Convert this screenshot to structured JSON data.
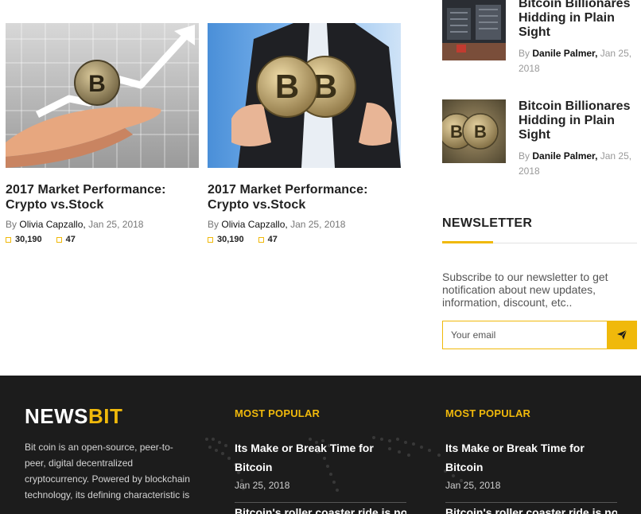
{
  "articles": [
    {
      "title": "2017 Market Performance: Crypto vs.Stock",
      "by": "By",
      "author": "Olivia Capzallo,",
      "date": "Jan 25, 2018",
      "views": "30,190",
      "comments": "47"
    },
    {
      "title": "2017 Market Performance: Crypto vs.Stock",
      "by": "By",
      "author": "Olivia Capzallo,",
      "date": "Jan 25, 2018",
      "views": "30,190",
      "comments": "47"
    }
  ],
  "sidebar_posts": [
    {
      "title": "Bitcoin Billionares Hidding in Plain Sight",
      "by": "By",
      "author": "Danile Palmer,",
      "date": "Jan 25, 2018"
    },
    {
      "title": "Bitcoin Billionares Hidding in Plain Sight",
      "by": "By",
      "author": "Danile Palmer,",
      "date": "Jan 25, 2018"
    }
  ],
  "newsletter": {
    "heading": "NEWSLETTER",
    "description": "Subscribe to our newsletter to get notification about new updates, information, discount, etc..",
    "email_placeholder": "Your email",
    "accent_color": "#f0b90b"
  },
  "footer": {
    "logo_part1": "NEWS",
    "logo_part2": "BIT",
    "about": "Bit coin is an open-source, peer-to-peer, digital decentralized cryptocurrency. Powered by blockchain technology, its defining characteristic is",
    "columns": [
      {
        "heading": "MOST POPULAR",
        "post_title": "Its Make or Break Time for Bitcoin",
        "post_date": "Jan 25, 2018",
        "next_title": "Bitcoin's roller coaster ride is not"
      },
      {
        "heading": "MOST POPULAR",
        "post_title": "Its Make or Break Time for Bitcoin",
        "post_date": "Jan 25, 2018",
        "next_title": "Bitcoin's roller coaster ride is not"
      }
    ],
    "background_color": "#1c1c1c"
  }
}
